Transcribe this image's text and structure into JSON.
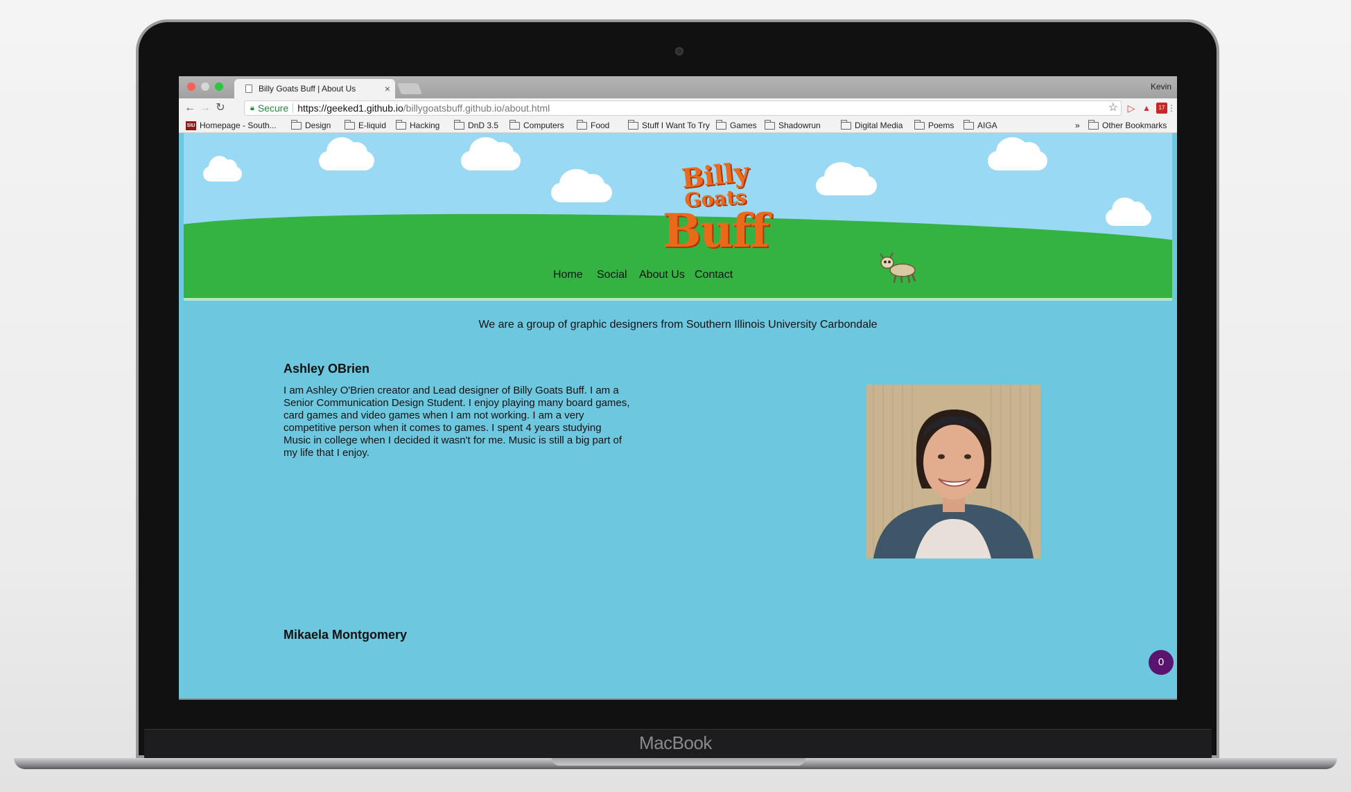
{
  "device": {
    "brand_label": "MacBook"
  },
  "browser": {
    "tab_title": "Billy Goats Buff | About Us",
    "tab_close": "×",
    "profile_name": "Kevin",
    "secure_label": "Secure",
    "url_host": "https://geeked1.github.io",
    "url_path": "/billygoatsbuff.github.io/about.html",
    "bookmarks": [
      {
        "label": "Homepage - South...",
        "icon": "siu-logo-icon"
      },
      {
        "label": "Design",
        "icon": "folder-icon"
      },
      {
        "label": "E-liquid",
        "icon": "folder-icon"
      },
      {
        "label": "Hacking",
        "icon": "folder-icon"
      },
      {
        "label": "DnD 3.5",
        "icon": "folder-icon"
      },
      {
        "label": "Computers",
        "icon": "folder-icon"
      },
      {
        "label": "Food",
        "icon": "folder-icon"
      },
      {
        "label": "Stuff I Want To Try",
        "icon": "folder-icon"
      },
      {
        "label": "Games",
        "icon": "folder-icon"
      },
      {
        "label": "Shadowrun",
        "icon": "folder-icon"
      },
      {
        "label": "Digital Media",
        "icon": "folder-icon"
      },
      {
        "label": "Poems",
        "icon": "folder-icon"
      },
      {
        "label": "AIGA",
        "icon": "folder-icon"
      }
    ],
    "bookmarks_overflow": "»",
    "other_bookmarks": "Other Bookmarks",
    "siu_badge": "SIU"
  },
  "site": {
    "logo": {
      "line1": "Billy",
      "line2": "Goats",
      "line3": "Buff"
    },
    "nav": [
      "Home",
      "Social",
      "About Us",
      "Contact"
    ],
    "intro": "We are a group of graphic designers from Southern Illinois University Carbondale",
    "members": [
      {
        "name": "Ashley OBrien",
        "bio": "I am Ashley O'Brien creator and Lead designer of Billy Goats Buff. I am a Senior Communication Design Student. I enjoy playing many board games, card games and video games when I am not working. I am a very competitive person when it comes to games. I spent 4 years studying Music in college when I decided it wasn't for me. Music is still a big part of my life that I enjoy."
      },
      {
        "name": "Mikaela Montgomery"
      }
    ],
    "floating_badge": "0"
  },
  "colors": {
    "page_background": "#6dc7df",
    "sky": "#9ad9f4",
    "grass": "#34b242",
    "logo_orange": "#ea6a1e",
    "badge_purple": "#5a136f"
  }
}
